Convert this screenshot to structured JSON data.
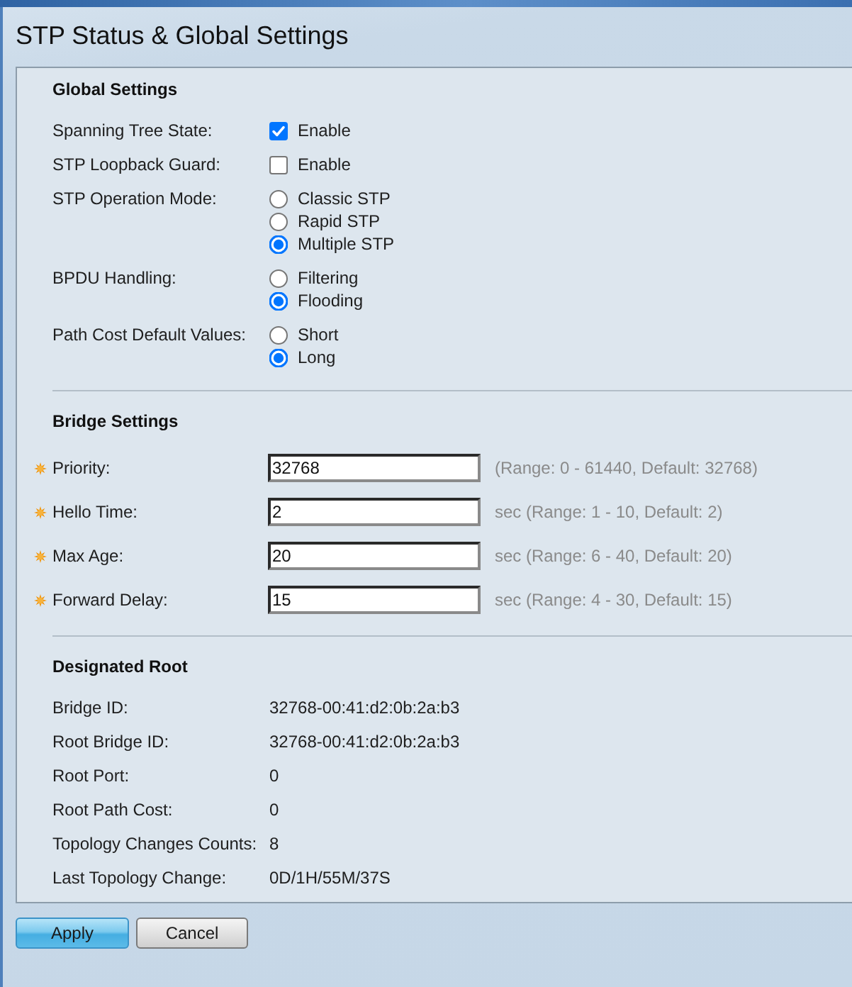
{
  "page": {
    "title": "STP Status & Global Settings"
  },
  "global_settings": {
    "heading": "Global Settings",
    "fields": [
      {
        "kind": "checkbox",
        "label": "Spanning Tree State:",
        "option": "Enable",
        "checked": true
      },
      {
        "kind": "checkbox",
        "label": "STP Loopback Guard:",
        "option": "Enable",
        "checked": false
      },
      {
        "kind": "radio",
        "label": "STP Operation Mode:",
        "options": [
          {
            "label": "Classic STP",
            "selected": false
          },
          {
            "label": "Rapid STP",
            "selected": false
          },
          {
            "label": "Multiple STP",
            "selected": true
          }
        ]
      },
      {
        "kind": "radio",
        "label": "BPDU Handling:",
        "options": [
          {
            "label": "Filtering",
            "selected": false
          },
          {
            "label": "Flooding",
            "selected": true
          }
        ]
      },
      {
        "kind": "radio",
        "label": "Path Cost Default Values:",
        "options": [
          {
            "label": "Short",
            "selected": false
          },
          {
            "label": "Long",
            "selected": true
          }
        ]
      }
    ]
  },
  "bridge_settings": {
    "heading": "Bridge Settings",
    "fields": [
      {
        "label": "Priority:",
        "required": true,
        "value": "32768",
        "hint": "(Range: 0 - 61440, Default: 32768)"
      },
      {
        "label": "Hello Time:",
        "required": true,
        "value": "2",
        "hint": "sec (Range: 1 - 10, Default: 2)"
      },
      {
        "label": "Max Age:",
        "required": true,
        "value": "20",
        "hint": "sec (Range: 6 - 40, Default: 20)"
      },
      {
        "label": "Forward Delay:",
        "required": true,
        "value": "15",
        "hint": "sec (Range: 4 - 30, Default: 15)"
      }
    ]
  },
  "designated_root": {
    "heading": "Designated Root",
    "rows": [
      {
        "label": "Bridge ID:",
        "value": "32768-00:41:d2:0b:2a:b3"
      },
      {
        "label": "Root Bridge ID:",
        "value": "32768-00:41:d2:0b:2a:b3"
      },
      {
        "label": "Root Port:",
        "value": "0"
      },
      {
        "label": "Root Path Cost:",
        "value": "0"
      },
      {
        "label": "Topology Changes Counts:",
        "value": "8"
      },
      {
        "label": "Last Topology Change:",
        "value": "0D/1H/55M/37S"
      }
    ]
  },
  "buttons": [
    {
      "label": "Apply",
      "kind": "primary"
    },
    {
      "label": "Cancel",
      "kind": "secondary"
    }
  ]
}
